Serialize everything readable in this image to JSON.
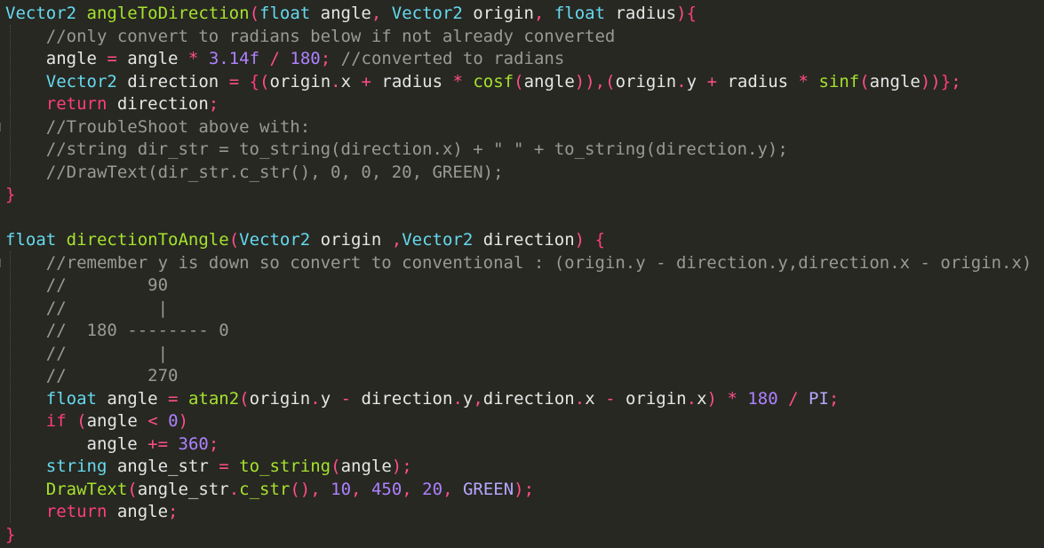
{
  "editor": {
    "language": "C++",
    "colors": {
      "background": "#272822",
      "keyword": "#ff3d7f",
      "type": "#66d9ef",
      "function": "#a6e22e",
      "identifier": "#e6e6e6",
      "number": "#ae81ff",
      "comment": "#9a9a94"
    },
    "lines": [
      {
        "tokens": [
          {
            "c": "ty",
            "t": "Vector2"
          },
          {
            "c": "id",
            "t": " "
          },
          {
            "c": "fn",
            "t": "angleToDirection"
          },
          {
            "c": "pa",
            "t": "("
          },
          {
            "c": "ty",
            "t": "float"
          },
          {
            "c": "id",
            "t": " angle"
          },
          {
            "c": "op",
            "t": ","
          },
          {
            "c": "id",
            "t": " "
          },
          {
            "c": "ty",
            "t": "Vector2"
          },
          {
            "c": "id",
            "t": " origin"
          },
          {
            "c": "op",
            "t": ","
          },
          {
            "c": "id",
            "t": " "
          },
          {
            "c": "ty",
            "t": "float"
          },
          {
            "c": "id",
            "t": " radius"
          },
          {
            "c": "pa",
            "t": ")"
          },
          {
            "c": "br",
            "t": "{"
          }
        ]
      },
      {
        "tokens": [
          {
            "c": "id",
            "t": "    "
          },
          {
            "c": "cm",
            "t": "//only convert to radians below if not already converted"
          }
        ]
      },
      {
        "tokens": [
          {
            "c": "id",
            "t": "    angle "
          },
          {
            "c": "op",
            "t": "="
          },
          {
            "c": "id",
            "t": " angle "
          },
          {
            "c": "op",
            "t": "*"
          },
          {
            "c": "id",
            "t": " "
          },
          {
            "c": "nm",
            "t": "3.14f"
          },
          {
            "c": "id",
            "t": " "
          },
          {
            "c": "op",
            "t": "/"
          },
          {
            "c": "id",
            "t": " "
          },
          {
            "c": "nm",
            "t": "180"
          },
          {
            "c": "op",
            "t": ";"
          },
          {
            "c": "id",
            "t": " "
          },
          {
            "c": "cm",
            "t": "//converted to radians"
          }
        ]
      },
      {
        "tokens": [
          {
            "c": "id",
            "t": "    "
          },
          {
            "c": "ty",
            "t": "Vector2"
          },
          {
            "c": "id",
            "t": " direction "
          },
          {
            "c": "op",
            "t": "="
          },
          {
            "c": "id",
            "t": " "
          },
          {
            "c": "br",
            "t": "{"
          },
          {
            "c": "pa",
            "t": "("
          },
          {
            "c": "id",
            "t": "origin"
          },
          {
            "c": "op",
            "t": "."
          },
          {
            "c": "id",
            "t": "x "
          },
          {
            "c": "op",
            "t": "+"
          },
          {
            "c": "id",
            "t": " radius "
          },
          {
            "c": "op",
            "t": "*"
          },
          {
            "c": "id",
            "t": " "
          },
          {
            "c": "fn",
            "t": "cosf"
          },
          {
            "c": "pa",
            "t": "("
          },
          {
            "c": "id",
            "t": "angle"
          },
          {
            "c": "pa",
            "t": "))"
          },
          {
            "c": "op",
            "t": ","
          },
          {
            "c": "pa",
            "t": "("
          },
          {
            "c": "id",
            "t": "origin"
          },
          {
            "c": "op",
            "t": "."
          },
          {
            "c": "id",
            "t": "y "
          },
          {
            "c": "op",
            "t": "+"
          },
          {
            "c": "id",
            "t": " radius "
          },
          {
            "c": "op",
            "t": "*"
          },
          {
            "c": "id",
            "t": " "
          },
          {
            "c": "fn",
            "t": "sinf"
          },
          {
            "c": "pa",
            "t": "("
          },
          {
            "c": "id",
            "t": "angle"
          },
          {
            "c": "pa",
            "t": "))"
          },
          {
            "c": "br",
            "t": "}"
          },
          {
            "c": "op",
            "t": ";"
          }
        ]
      },
      {
        "tokens": [
          {
            "c": "id",
            "t": "    "
          },
          {
            "c": "kw",
            "t": "return"
          },
          {
            "c": "id",
            "t": " direction"
          },
          {
            "c": "op",
            "t": ";"
          }
        ]
      },
      {
        "tokens": [
          {
            "c": "id",
            "t": "    "
          },
          {
            "c": "cm",
            "t": "//TroubleShoot above with:"
          }
        ]
      },
      {
        "tokens": [
          {
            "c": "id",
            "t": "    "
          },
          {
            "c": "cm",
            "t": "//string dir_str = to_string(direction.x) + \" \" + to_string(direction.y);"
          }
        ]
      },
      {
        "tokens": [
          {
            "c": "id",
            "t": "    "
          },
          {
            "c": "cm",
            "t": "//DrawText(dir_str.c_str(), 0, 0, 20, GREEN);"
          }
        ]
      },
      {
        "tokens": [
          {
            "c": "br",
            "t": "}"
          }
        ]
      },
      {
        "tokens": []
      },
      {
        "tokens": [
          {
            "c": "ty",
            "t": "float"
          },
          {
            "c": "id",
            "t": " "
          },
          {
            "c": "fn",
            "t": "directionToAngle"
          },
          {
            "c": "pa",
            "t": "("
          },
          {
            "c": "ty",
            "t": "Vector2"
          },
          {
            "c": "id",
            "t": " origin "
          },
          {
            "c": "op",
            "t": ","
          },
          {
            "c": "ty",
            "t": "Vector2"
          },
          {
            "c": "id",
            "t": " direction"
          },
          {
            "c": "pa",
            "t": ")"
          },
          {
            "c": "id",
            "t": " "
          },
          {
            "c": "br",
            "t": "{"
          }
        ]
      },
      {
        "tokens": [
          {
            "c": "id",
            "t": "    "
          },
          {
            "c": "cm",
            "t": "//remember y is down so convert to conventional : (origin.y - direction.y,direction.x - origin.x)"
          }
        ]
      },
      {
        "tokens": [
          {
            "c": "id",
            "t": "    "
          },
          {
            "c": "cm",
            "t": "//        90"
          }
        ]
      },
      {
        "tokens": [
          {
            "c": "id",
            "t": "    "
          },
          {
            "c": "cm",
            "t": "//         |"
          }
        ]
      },
      {
        "tokens": [
          {
            "c": "id",
            "t": "    "
          },
          {
            "c": "cm",
            "t": "//  180 -------- 0"
          }
        ]
      },
      {
        "tokens": [
          {
            "c": "id",
            "t": "    "
          },
          {
            "c": "cm",
            "t": "//         |"
          }
        ]
      },
      {
        "tokens": [
          {
            "c": "id",
            "t": "    "
          },
          {
            "c": "cm",
            "t": "//        270"
          }
        ]
      },
      {
        "tokens": [
          {
            "c": "id",
            "t": "    "
          },
          {
            "c": "ty",
            "t": "float"
          },
          {
            "c": "id",
            "t": " angle "
          },
          {
            "c": "op",
            "t": "="
          },
          {
            "c": "id",
            "t": " "
          },
          {
            "c": "fn",
            "t": "atan2"
          },
          {
            "c": "pa",
            "t": "("
          },
          {
            "c": "id",
            "t": "origin"
          },
          {
            "c": "op",
            "t": "."
          },
          {
            "c": "id",
            "t": "y "
          },
          {
            "c": "op",
            "t": "-"
          },
          {
            "c": "id",
            "t": " direction"
          },
          {
            "c": "op",
            "t": "."
          },
          {
            "c": "id",
            "t": "y"
          },
          {
            "c": "op",
            "t": ","
          },
          {
            "c": "id",
            "t": "direction"
          },
          {
            "c": "op",
            "t": "."
          },
          {
            "c": "id",
            "t": "x "
          },
          {
            "c": "op",
            "t": "-"
          },
          {
            "c": "id",
            "t": " origin"
          },
          {
            "c": "op",
            "t": "."
          },
          {
            "c": "id",
            "t": "x"
          },
          {
            "c": "pa",
            "t": ")"
          },
          {
            "c": "id",
            "t": " "
          },
          {
            "c": "op",
            "t": "*"
          },
          {
            "c": "id",
            "t": " "
          },
          {
            "c": "nm",
            "t": "180"
          },
          {
            "c": "id",
            "t": " "
          },
          {
            "c": "op",
            "t": "/"
          },
          {
            "c": "id",
            "t": " "
          },
          {
            "c": "cst",
            "t": "PI"
          },
          {
            "c": "op",
            "t": ";"
          }
        ]
      },
      {
        "tokens": [
          {
            "c": "id",
            "t": "    "
          },
          {
            "c": "kw",
            "t": "if"
          },
          {
            "c": "id",
            "t": " "
          },
          {
            "c": "pa",
            "t": "("
          },
          {
            "c": "id",
            "t": "angle "
          },
          {
            "c": "op",
            "t": "<"
          },
          {
            "c": "id",
            "t": " "
          },
          {
            "c": "nm",
            "t": "0"
          },
          {
            "c": "pa",
            "t": ")"
          }
        ]
      },
      {
        "tokens": [
          {
            "c": "id",
            "t": "        angle "
          },
          {
            "c": "op",
            "t": "+="
          },
          {
            "c": "id",
            "t": " "
          },
          {
            "c": "nm",
            "t": "360"
          },
          {
            "c": "op",
            "t": ";"
          }
        ]
      },
      {
        "tokens": [
          {
            "c": "id",
            "t": "    "
          },
          {
            "c": "ty",
            "t": "string"
          },
          {
            "c": "id",
            "t": " angle_str "
          },
          {
            "c": "op",
            "t": "="
          },
          {
            "c": "id",
            "t": " "
          },
          {
            "c": "fn",
            "t": "to_string"
          },
          {
            "c": "pa",
            "t": "("
          },
          {
            "c": "id",
            "t": "angle"
          },
          {
            "c": "pa",
            "t": ")"
          },
          {
            "c": "op",
            "t": ";"
          }
        ]
      },
      {
        "tokens": [
          {
            "c": "id",
            "t": "    "
          },
          {
            "c": "fn",
            "t": "DrawText"
          },
          {
            "c": "pa",
            "t": "("
          },
          {
            "c": "id",
            "t": "angle_str"
          },
          {
            "c": "op",
            "t": "."
          },
          {
            "c": "fn",
            "t": "c_str"
          },
          {
            "c": "pa",
            "t": "()"
          },
          {
            "c": "op",
            "t": ","
          },
          {
            "c": "id",
            "t": " "
          },
          {
            "c": "nm",
            "t": "10"
          },
          {
            "c": "op",
            "t": ","
          },
          {
            "c": "id",
            "t": " "
          },
          {
            "c": "nm",
            "t": "450"
          },
          {
            "c": "op",
            "t": ","
          },
          {
            "c": "id",
            "t": " "
          },
          {
            "c": "nm",
            "t": "20"
          },
          {
            "c": "op",
            "t": ","
          },
          {
            "c": "id",
            "t": " "
          },
          {
            "c": "cst",
            "t": "GREEN"
          },
          {
            "c": "pa",
            "t": ")"
          },
          {
            "c": "op",
            "t": ";"
          }
        ]
      },
      {
        "tokens": [
          {
            "c": "id",
            "t": "    "
          },
          {
            "c": "kw",
            "t": "return"
          },
          {
            "c": "id",
            "t": " angle"
          },
          {
            "c": "op",
            "t": ";"
          }
        ]
      },
      {
        "tokens": [
          {
            "c": "br",
            "t": "}"
          }
        ]
      }
    ]
  }
}
